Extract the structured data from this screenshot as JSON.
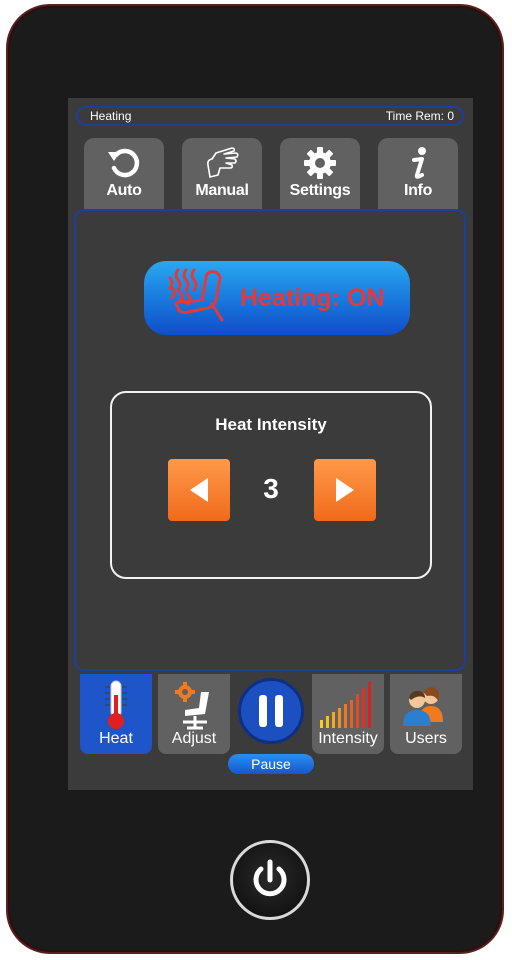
{
  "status": {
    "mode_label": "Heating",
    "time_remaining": "Time Rem: 0"
  },
  "top_tabs": [
    {
      "label": "Auto",
      "icon": "refresh-icon"
    },
    {
      "label": "Manual",
      "icon": "hand-pointer-icon"
    },
    {
      "label": "Settings",
      "icon": "gear-icon"
    },
    {
      "label": "Info",
      "icon": "info-icon"
    }
  ],
  "heating": {
    "button_label": "Heating: ON",
    "icon": "heated-seat-icon",
    "label_color": "#e23a3a"
  },
  "intensity": {
    "title": "Heat Intensity",
    "value": "3",
    "decrease_icon": "triangle-left-icon",
    "increase_icon": "triangle-right-icon"
  },
  "bottom_nav": [
    {
      "label": "Heat",
      "icon": "thermometer-icon",
      "active": true
    },
    {
      "label": "Adjust",
      "icon": "seat-adjust-icon",
      "active": false
    },
    {
      "label": "Intensity",
      "icon": "signal-bars-icon",
      "active": false
    },
    {
      "label": "Users",
      "icon": "users-icon",
      "active": false
    }
  ],
  "pause": {
    "label": "Pause",
    "icon": "pause-icon"
  },
  "power": {
    "icon": "power-icon"
  },
  "colors": {
    "accent_blue": "#1e55c8",
    "panel_border": "#1d3f9a",
    "orange": "#f06a1a",
    "screen_bg": "#3b3b3b"
  }
}
